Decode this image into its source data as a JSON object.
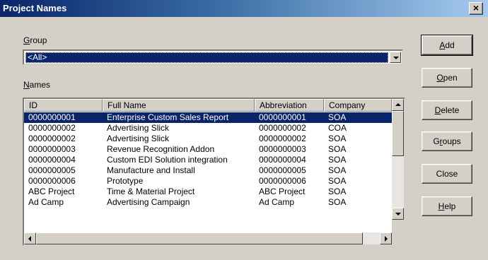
{
  "window": {
    "title": "Project Names",
    "close_symbol": "×"
  },
  "group": {
    "label_hotkey": "G",
    "label_rest": "roup",
    "selected": "<All>"
  },
  "names": {
    "label_hotkey": "N",
    "label_rest": "ames",
    "columns": [
      "ID",
      "Full Name",
      "Abbreviation",
      "Company"
    ],
    "rows": [
      [
        "0000000001",
        "Enterprise Custom Sales Report",
        "0000000001",
        "SOA"
      ],
      [
        "0000000002",
        "Advertising Slick",
        "0000000002",
        "COA"
      ],
      [
        "0000000002",
        "Advertising Slick",
        "0000000002",
        "SOA"
      ],
      [
        "0000000003",
        "Revenue Recognition Addon",
        "0000000003",
        "SOA"
      ],
      [
        "0000000004",
        "Custom EDI Solution integration",
        "0000000004",
        "SOA"
      ],
      [
        "0000000005",
        "Manufacture and Install",
        "0000000005",
        "SOA"
      ],
      [
        "0000000006",
        "Prototype",
        "0000000006",
        "SOA"
      ],
      [
        "ABC Project",
        "Time & Material Project",
        "ABC Project",
        "SOA"
      ],
      [
        "Ad Camp",
        "Advertising Campaign",
        "Ad Camp",
        "SOA"
      ]
    ],
    "selected_row": 0
  },
  "buttons": [
    {
      "pre": "",
      "hot": "A",
      "post": "dd"
    },
    {
      "pre": "",
      "hot": "O",
      "post": "pen"
    },
    {
      "pre": "",
      "hot": "D",
      "post": "elete"
    },
    {
      "pre": "G",
      "hot": "r",
      "post": "oups"
    },
    {
      "pre": "Close",
      "hot": "",
      "post": ""
    },
    {
      "pre": "",
      "hot": "H",
      "post": "elp"
    }
  ],
  "colors": {
    "selection": "#0a246a",
    "dialog_face": "#d4d0c8",
    "title_start": "#0a246a",
    "title_end": "#a6caf0"
  },
  "icons": [
    "close-icon",
    "chevron-down-icon",
    "scroll-up-icon",
    "scroll-down-icon",
    "scroll-left-icon",
    "scroll-right-icon"
  ]
}
